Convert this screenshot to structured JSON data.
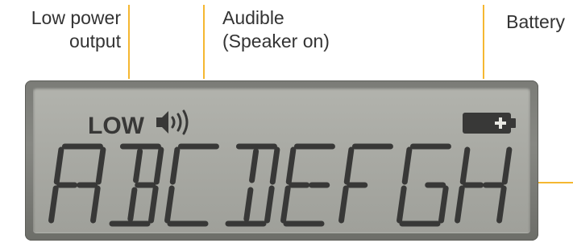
{
  "callouts": {
    "low_power_line1": "Low power",
    "low_power_line2": "output",
    "audible_line1": "Audible",
    "audible_line2": "(Speaker on)",
    "battery": "Battery"
  },
  "lcd": {
    "low_indicator": "LOW",
    "speaker_icon": "speaker-on-icon",
    "battery_icon": "battery-icon",
    "display_text": "ABCDEFGH"
  },
  "colors": {
    "callout_line": "#f5b731",
    "lcd_segment": "#383837",
    "lcd_background": "#a8a9a3",
    "bezel": "#7b7c77"
  }
}
